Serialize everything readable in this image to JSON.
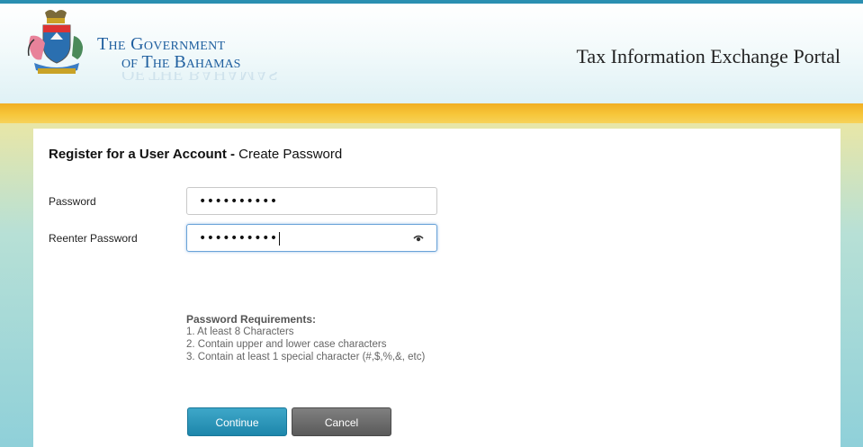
{
  "header": {
    "gov_line1": "The Government",
    "gov_line2": "of The Bahamas",
    "portal_title": "Tax Information Exchange Portal",
    "crest_icon": "bahamas-coat-of-arms-icon"
  },
  "form": {
    "heading_bold": "Register for a User Account -",
    "heading_rest": " Create Password",
    "password_label": "Password",
    "password_value": "••••••••••",
    "reenter_label": "Reenter Password",
    "reenter_value": "••••••••••",
    "reveal_icon": "eye-reveal-icon"
  },
  "requirements": {
    "title": "Password Requirements:",
    "items": [
      "1.  At least 8 Characters",
      "2.  Contain upper and lower case characters",
      "3.  Contain at least 1 special character (#,$,%,&, etc)"
    ]
  },
  "buttons": {
    "continue": "Continue",
    "cancel": "Cancel"
  },
  "colors": {
    "header_border": "#2b8fb1",
    "gov_title": "#1f5f9f",
    "continue_button": "#2a96bb",
    "cancel_button": "#6b6b6b"
  }
}
